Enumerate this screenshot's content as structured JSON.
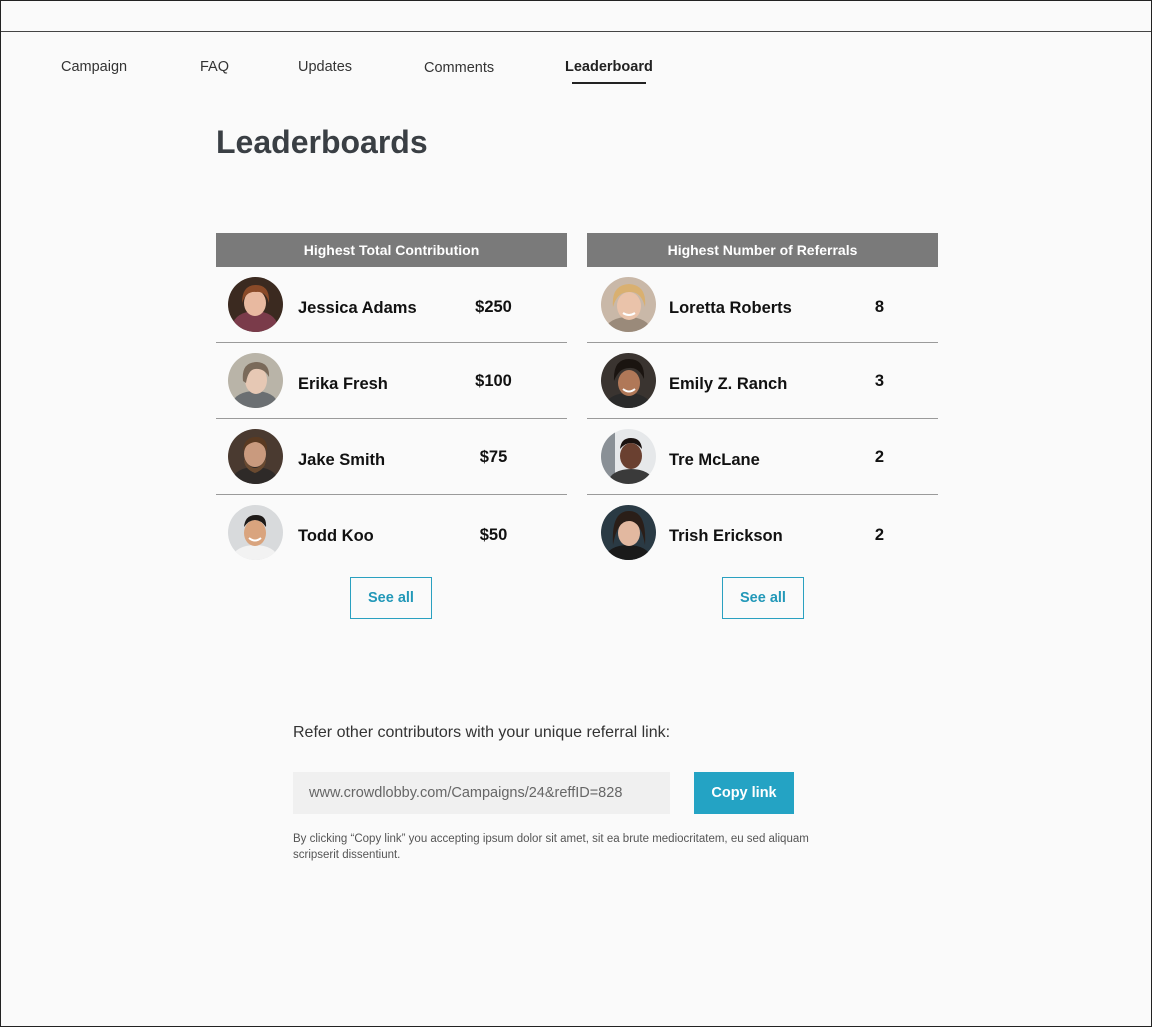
{
  "nav": {
    "items": [
      {
        "label": "Campaign"
      },
      {
        "label": "FAQ"
      },
      {
        "label": "Updates"
      },
      {
        "label": "Comments"
      },
      {
        "label": "Leaderboard",
        "active": true
      }
    ]
  },
  "page": {
    "title": "Leaderboards"
  },
  "contribution_board": {
    "header": "Highest Total Contribution",
    "rows": [
      {
        "name": "Jessica Adams",
        "value": "$250"
      },
      {
        "name": "Erika Fresh",
        "value": "$100"
      },
      {
        "name": "Jake Smith",
        "value": "$75"
      },
      {
        "name": "Todd Koo",
        "value": "$50"
      }
    ],
    "see_all": "See all"
  },
  "referral_board": {
    "header": "Highest Number of Referrals",
    "rows": [
      {
        "name": "Loretta Roberts",
        "value": "8"
      },
      {
        "name": "Emily Z. Ranch",
        "value": "3"
      },
      {
        "name": "Tre McLane",
        "value": "2"
      },
      {
        "name": "Trish Erickson",
        "value": "2"
      }
    ],
    "see_all": "See all"
  },
  "referral": {
    "prompt": "Refer other contributors with your unique referral link:",
    "link_value": "www.crowdlobby.com/Campaigns/24&reffID=828",
    "copy_label": "Copy link",
    "disclaimer": "By clicking “Copy link” you accepting ipsum dolor sit amet, sit ea brute mediocritatem, eu sed aliquam scripserit dissentiunt."
  },
  "colors": {
    "accent": "#24a3c4",
    "header_gray": "#7a7a7a"
  }
}
